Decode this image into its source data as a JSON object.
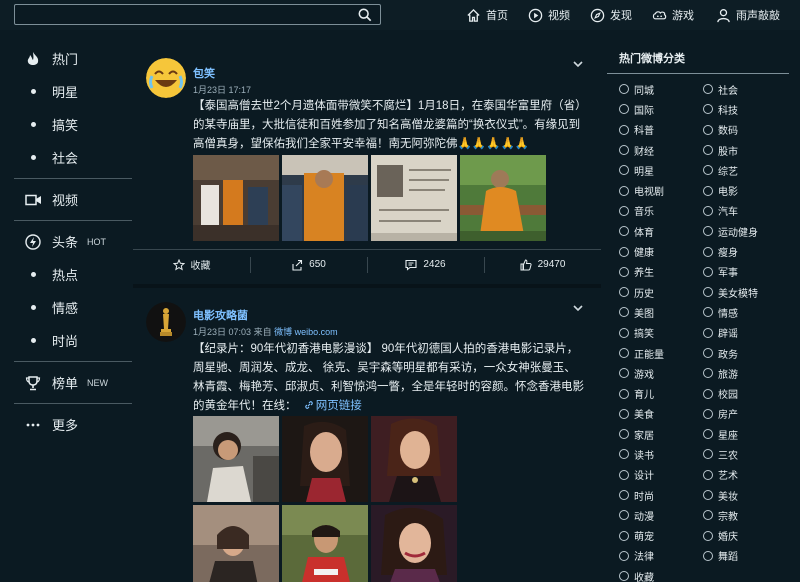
{
  "search": {
    "placeholder": ""
  },
  "nav": [
    {
      "label": "首页",
      "icon": "home-icon"
    },
    {
      "label": "视频",
      "icon": "video-icon"
    },
    {
      "label": "发现",
      "icon": "compass-icon"
    },
    {
      "label": "游戏",
      "icon": "game-icon"
    },
    {
      "label": "雨声敲敲",
      "icon": "user-icon"
    }
  ],
  "sidebar": {
    "items": [
      {
        "label": "热门"
      },
      {
        "label": "明星"
      },
      {
        "label": "搞笑"
      },
      {
        "label": "社会"
      },
      {
        "label": "视频"
      },
      {
        "label": "头条",
        "badge": "HOT"
      },
      {
        "label": "热点"
      },
      {
        "label": "情感"
      },
      {
        "label": "时尚"
      },
      {
        "label": "榜单",
        "badge": "NEW"
      },
      {
        "label": "更多"
      }
    ]
  },
  "posts": [
    {
      "author": "包笑",
      "time": "1月23日 17:17",
      "text": "【泰国高僧去世2个月遗体面带微笑不腐烂】1月18日，在泰国华富里府（省）的某寺庙里，大批信徒和百姓参加了知名高僧龙婆篇的“换衣仪式”。有缘见到高僧真身，望保佑我们全家平安幸福！南无阿弥陀佛🙏🙏🙏🙏🙏",
      "actions": {
        "fav": "收藏",
        "repost": "650",
        "comment": "2426",
        "like": "29470"
      }
    },
    {
      "author": "电影攻略菌",
      "time": "1月23日 07:03",
      "via": "来自",
      "source": "微博 weibo.com",
      "text": "【纪录片：90年代初香港电影漫谈】 90年代初德国人拍的香港电影记录片，周星驰、周润发、成龙、 徐克、吴宇森等明星都有采访，一众女神张曼玉、林青霞、梅艳芳、邱淑贞、利智惊鸿一瞥，全是年轻时的容颜。怀念香港电影的黄金年代！在线：",
      "link": "网页链接"
    }
  ],
  "right": {
    "title": "热门微博分类",
    "categories": [
      "同城",
      "社会",
      "国际",
      "科技",
      "科普",
      "数码",
      "财经",
      "股市",
      "明星",
      "综艺",
      "电视剧",
      "电影",
      "音乐",
      "汽车",
      "体育",
      "运动健身",
      "健康",
      "瘦身",
      "养生",
      "军事",
      "历史",
      "美女模特",
      "美图",
      "情感",
      "搞笑",
      "辟谣",
      "正能量",
      "政务",
      "游戏",
      "旅游",
      "育儿",
      "校园",
      "美食",
      "房产",
      "家居",
      "星座",
      "读书",
      "三农",
      "设计",
      "艺术",
      "时尚",
      "美妆",
      "动漫",
      "宗教",
      "萌宠",
      "婚庆",
      "法律",
      "舞蹈",
      "收藏"
    ]
  }
}
